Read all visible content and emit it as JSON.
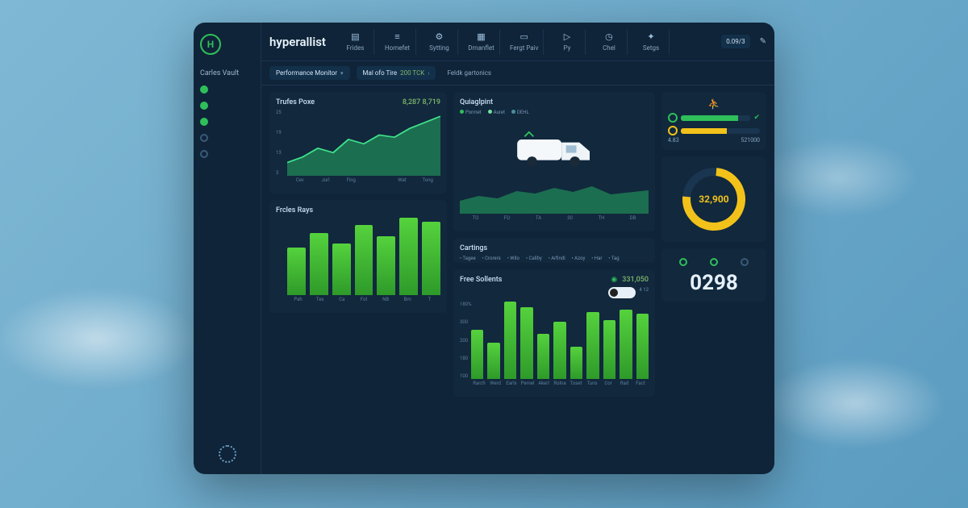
{
  "brand": "hyperallist",
  "sidebar": {
    "title": "Carles Vault",
    "items": [
      {
        "active": true
      },
      {
        "active": true
      },
      {
        "active": true
      },
      {
        "active": false
      },
      {
        "active": false
      }
    ]
  },
  "topnav": {
    "monitor_label": "Performance Monitor",
    "tabs": [
      {
        "label": "Frides"
      },
      {
        "label": "Homefet"
      },
      {
        "label": "Sytting"
      },
      {
        "label": "Drnanflet"
      },
      {
        "label": "Fergt Paiv"
      },
      {
        "label": "Py"
      },
      {
        "label": "Chel"
      },
      {
        "label": "Setgs"
      }
    ],
    "readout": "0.09/3",
    "edit_glyph": "✎"
  },
  "rowbar": {
    "tile_label": "Mal ofo Tire",
    "tile_value": "200 TCK",
    "section2": "Feldk gartonics"
  },
  "card_price": {
    "title": "Trufes Poxe",
    "value": "8,287 8,719"
  },
  "card_rays": {
    "title": "Frcles Rays"
  },
  "card_quiag": {
    "title": "Quiaglpint",
    "legend": [
      "Pormet",
      "Auret",
      "DEHL"
    ]
  },
  "card_cartings": {
    "title": "Cartings",
    "legend": [
      "Tagee",
      "Crorers",
      "Wilo",
      "Caliby",
      "Arfindi",
      "Azoy",
      "Har",
      "Tag"
    ]
  },
  "card_sollents": {
    "title": "Free Sollents",
    "badge_value": "331,050",
    "toggle_label": "4 12"
  },
  "rail": {
    "person_glyph": "⛹",
    "prog1_pct": 82,
    "prog2_pct": 58,
    "stat1": "4.83",
    "stat2": "521000",
    "ring_value": "32,900",
    "big_number": "0298"
  },
  "colors": {
    "green": "#2fbf5a",
    "bar_green": "#4cc93a",
    "yellow": "#f2c21a",
    "panel": "#0f2438"
  },
  "chart_data": [
    {
      "id": "trufes_poxe",
      "type": "area",
      "title": "Trufes Poxe",
      "y_ticks": [
        25,
        19,
        13,
        3
      ],
      "categories": [
        "Cev",
        "Jurl",
        "Fing",
        "",
        "Wat",
        "Tong"
      ],
      "values": [
        20,
        28,
        42,
        34,
        55,
        48,
        62,
        58,
        72,
        90
      ]
    },
    {
      "id": "quiaglpint",
      "type": "area",
      "title": "Quiaglpint",
      "categories": [
        "TO",
        "FO",
        "TA",
        "30",
        "TH",
        "DB"
      ],
      "values": [
        40,
        55,
        48,
        70,
        62,
        80,
        68,
        85,
        60,
        72
      ]
    },
    {
      "id": "frcles_rays",
      "type": "bar",
      "title": "Frcles Rays",
      "categories": [
        "Pah",
        "Tes",
        "Ca",
        "Fol",
        "NB",
        "Bm",
        "T"
      ],
      "values": [
        55,
        72,
        60,
        82,
        68,
        90,
        85
      ]
    },
    {
      "id": "free_sollents",
      "type": "bar",
      "title": "Free Sollents",
      "y_ticks": [
        "180%",
        "300",
        "200",
        "180",
        "100"
      ],
      "categories": [
        "Rarch",
        "Werd",
        "Earls",
        "Pemel",
        "Akerl",
        "Rolna",
        "Toset",
        "Tuns",
        "Cor",
        "Rad",
        "Fact"
      ],
      "values": [
        60,
        45,
        95,
        88,
        55,
        70,
        40,
        82,
        72,
        85,
        80
      ]
    }
  ]
}
